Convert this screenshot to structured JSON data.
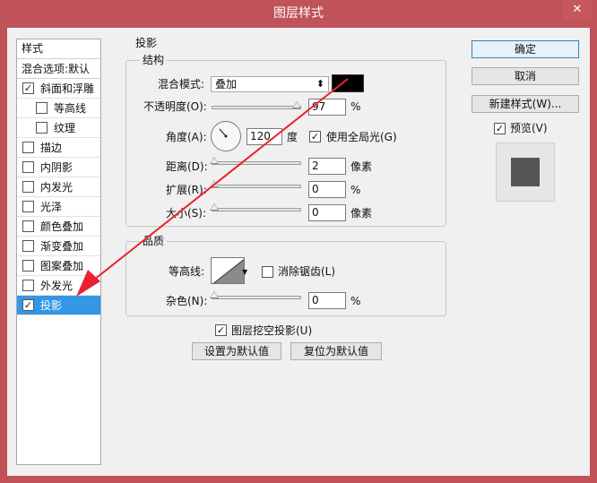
{
  "window": {
    "title": "图层样式",
    "close_label": "✕"
  },
  "styles_list": {
    "header": "样式",
    "blend_default": "混合选项:默认",
    "items": [
      {
        "label": "斜面和浮雕",
        "checked": true,
        "sub": false
      },
      {
        "label": "等高线",
        "checked": false,
        "sub": true
      },
      {
        "label": "纹理",
        "checked": false,
        "sub": true
      },
      {
        "label": "描边",
        "checked": false,
        "sub": false
      },
      {
        "label": "内阴影",
        "checked": false,
        "sub": false
      },
      {
        "label": "内发光",
        "checked": false,
        "sub": false
      },
      {
        "label": "光泽",
        "checked": false,
        "sub": false
      },
      {
        "label": "颜色叠加",
        "checked": false,
        "sub": false
      },
      {
        "label": "渐变叠加",
        "checked": false,
        "sub": false
      },
      {
        "label": "图案叠加",
        "checked": false,
        "sub": false
      },
      {
        "label": "外发光",
        "checked": false,
        "sub": false
      },
      {
        "label": "投影",
        "checked": true,
        "sub": false,
        "selected": true
      }
    ]
  },
  "drop_shadow": {
    "title": "投影",
    "structure": {
      "title": "结构",
      "blend_mode_label": "混合模式:",
      "blend_mode_value": "叠加",
      "shadow_color": "#000000",
      "opacity_label": "不透明度(O):",
      "opacity_value": "97",
      "opacity_unit": "%",
      "angle_label": "角度(A):",
      "angle_value": "120",
      "angle_unit": "度",
      "global_light_label": "使用全局光(G)",
      "global_light_checked": true,
      "distance_label": "距离(D):",
      "distance_value": "2",
      "distance_unit": "像素",
      "spread_label": "扩展(R):",
      "spread_value": "0",
      "spread_unit": "%",
      "size_label": "大小(S):",
      "size_value": "0",
      "size_unit": "像素"
    },
    "quality": {
      "title": "品质",
      "contour_label": "等高线:",
      "anti_alias_label": "消除锯齿(L)",
      "anti_alias_checked": false,
      "noise_label": "杂色(N):",
      "noise_value": "0",
      "noise_unit": "%"
    },
    "knockout_label": "图层挖空投影(U)",
    "knockout_checked": true,
    "make_default_label": "设置为默认值",
    "reset_default_label": "复位为默认值"
  },
  "side_buttons": {
    "ok": "确定",
    "cancel": "取消",
    "new_style": "新建样式(W)...",
    "preview_label": "预览(V)",
    "preview_checked": true
  },
  "colors": {
    "title_bar": "#c0525a",
    "selected": "#3397e6",
    "annotation_arrow": "#e8232f"
  }
}
